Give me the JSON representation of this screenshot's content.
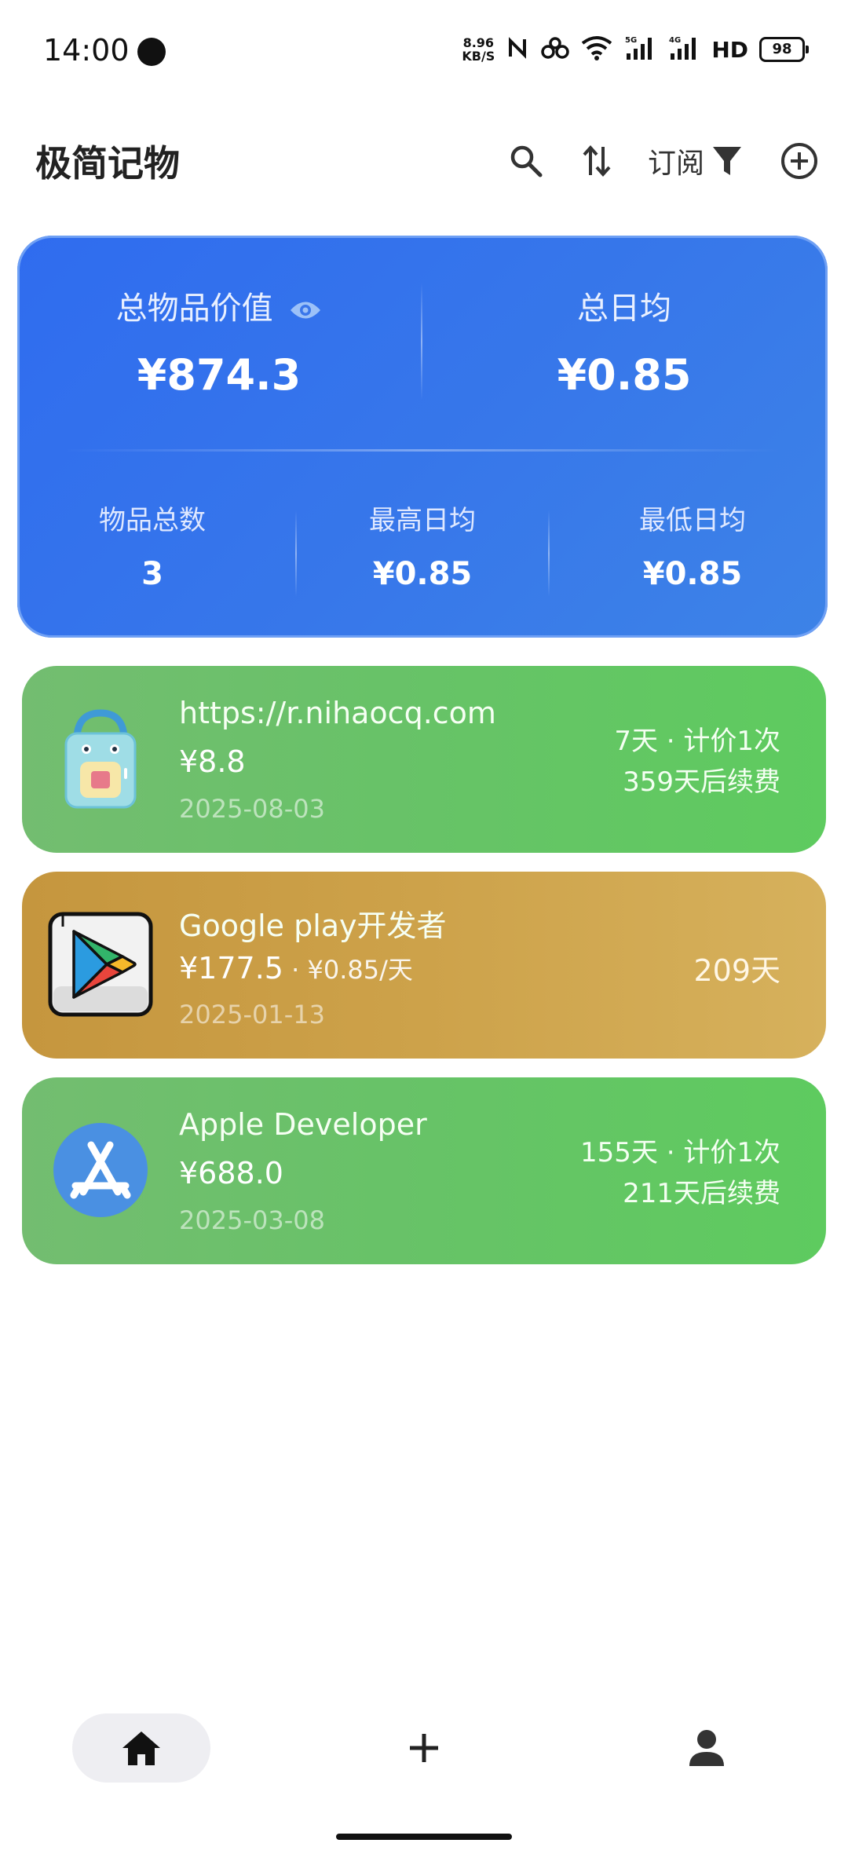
{
  "status_bar": {
    "time": "14:00",
    "net_speed_value": "8.96",
    "net_speed_unit": "KB/S",
    "hd_label": "HD",
    "battery": "98"
  },
  "header": {
    "title": "极简记物",
    "subscribe_label": "订阅"
  },
  "summary": {
    "total_value_label": "总物品价值",
    "total_value": "¥874.3",
    "total_daily_label": "总日均",
    "total_daily": "¥0.85",
    "count_label": "物品总数",
    "count": "3",
    "max_daily_label": "最高日均",
    "max_daily": "¥0.85",
    "min_daily_label": "最低日均",
    "min_daily": "¥0.85"
  },
  "items": [
    {
      "name": "https://r.nihaocq.com",
      "price": "¥8.8",
      "date": "2025-08-03",
      "days": "7天 · 计价1次",
      "renew": "359天后续费"
    },
    {
      "name": "Google play开发者",
      "price": "¥177.5",
      "per_day": " · ¥0.85/天",
      "date": "2025-01-13",
      "days": "209天"
    },
    {
      "name": "Apple Developer",
      "price": "¥688.0",
      "date": "2025-03-08",
      "days": "155天 · 计价1次",
      "renew": "211天后续费"
    }
  ],
  "icons": {
    "search": "search-icon",
    "sort": "sort-icon",
    "filter": "filter-icon",
    "add": "add-circle-icon",
    "eye": "eye-icon",
    "home": "home-icon",
    "plus": "plus-icon",
    "profile": "person-icon"
  },
  "colors": {
    "summary_card": "#2f6cef",
    "green_card": "#68c268",
    "gold_card": "#cda24a"
  }
}
